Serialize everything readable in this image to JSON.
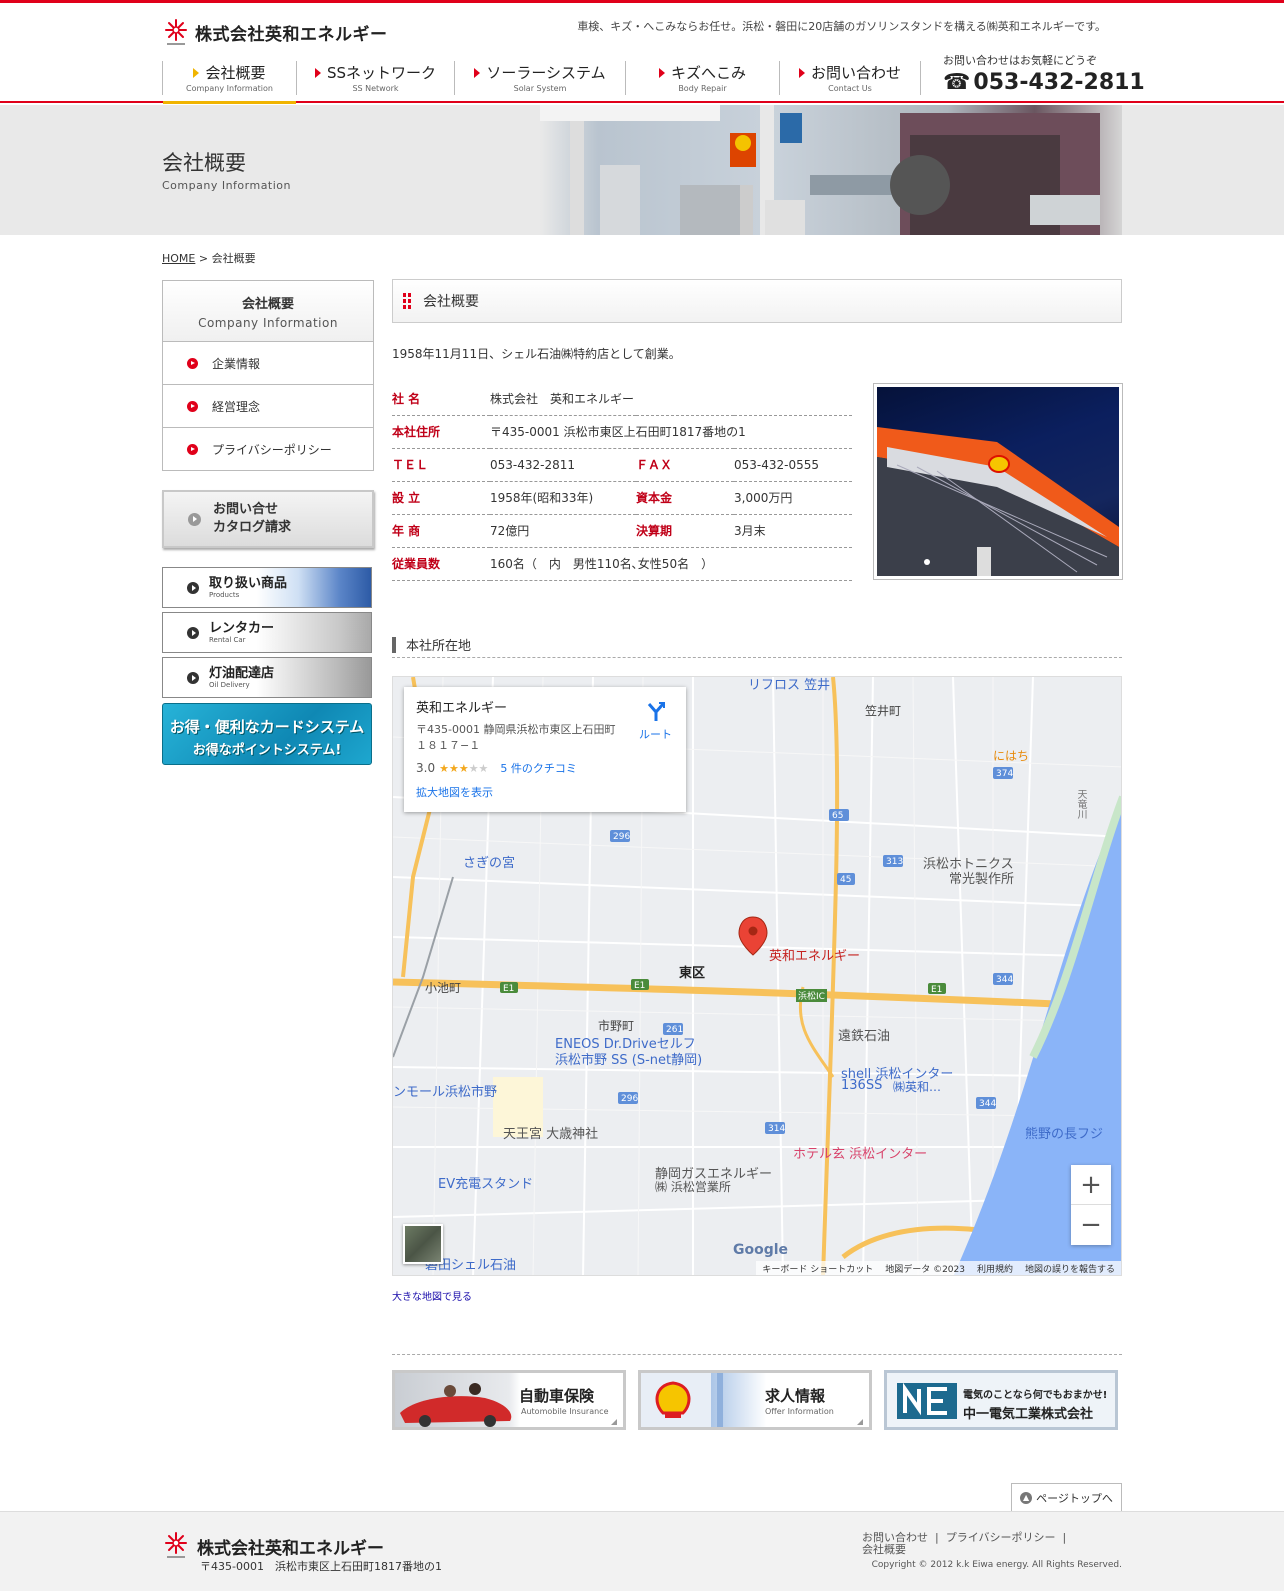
{
  "header": {
    "logo_text": "株式会社英和エネルギー",
    "tagline": "車検、キズ・へこみならお任せ。浜松・磐田に20店舗のガソリンスタンドを構える㈱英和エネルギーです。",
    "tel_note": "お問い合わせはお気軽にどうぞ",
    "tel": "053-432-2811",
    "nav": [
      {
        "jp": "会社概要",
        "en": "Company Information"
      },
      {
        "jp": "SSネットワーク",
        "en": "SS Network"
      },
      {
        "jp": "ソーラーシステム",
        "en": "Solar System"
      },
      {
        "jp": "キズへこみ",
        "en": "Body Repair"
      },
      {
        "jp": "お問い合わせ",
        "en": "Contact Us"
      }
    ]
  },
  "hero": {
    "title": "会社概要",
    "subtitle": "Company Information"
  },
  "breadcrumb": {
    "home": "HOME",
    "sep": " > ",
    "current": "会社概要"
  },
  "sidebar": {
    "head_jp": "会社概要",
    "head_en": "Company Information",
    "items": [
      "企業情報",
      "経営理念",
      "プライバシーポリシー"
    ],
    "contact_l1": "お問い合せ",
    "contact_l2": "カタログ請求",
    "banners": [
      {
        "jp": "取り扱い商品",
        "en": "Products"
      },
      {
        "jp": "レンタカー",
        "en": "Rental Car"
      },
      {
        "jp": "灯油配達店",
        "en": "Oil Delivery"
      }
    ],
    "card_l1": "お得・便利なカードシステム",
    "card_l2": "お得なポイントシステム!"
  },
  "main": {
    "section_title": "会社概要",
    "intro": "1958年11月11日、シェル石油㈱特約店として創業。",
    "info": {
      "name_k": "社 名",
      "name_v": "株式会社　英和エネルギー",
      "addr_k": "本社住所",
      "addr_v": "〒435-0001 浜松市東区上石田町1817番地の1",
      "tel_k": "ＴＥＬ",
      "tel_v": "053-432-2811",
      "fax_k": "ＦＡＸ",
      "fax_v": "053-432-0555",
      "est_k": "設 立",
      "est_v": "1958年(昭和33年)",
      "cap_k": "資本金",
      "cap_v": "3,000万円",
      "sales_k": "年 商",
      "sales_v": "72億円",
      "fy_k": "決算期",
      "fy_v": "3月末",
      "emp_k": "従業員数",
      "emp_v": "160名（　内　男性110名､女性50名　）"
    },
    "map_title": "本社所在地",
    "map": {
      "card_name": "英和エネルギー",
      "card_addr": "〒435-0001 静岡県浜松市東区上石田町１８１７−１",
      "rating": "3.0",
      "reviews": "5 件のクチコミ",
      "enlarge": "拡大地図を表示",
      "route": "ルート",
      "pin_label": "英和エネルギー",
      "labels": {
        "l1": "リフロス 笠井",
        "l2": "笠井町",
        "l3": "にはち",
        "l4": "さぎの宮",
        "l5": "浜松ホトニクス",
        "l6": "常光製作所",
        "l7": "東区",
        "l8": "小池町",
        "l9": "浜松IC",
        "l10": "市野町",
        "l11": "遠鉄石油",
        "l12": "ENEOS Dr.Driveセルフ",
        "l13": "浜松市野 SS (S-net静岡)",
        "l14": "shell 浜松インター",
        "l15": "136SS",
        "l16": "㈱英和…",
        "l17": "ンモール浜松市野",
        "l18": "天王宮 大歳神社",
        "l19": "ホテル玄 浜松インター",
        "l20": "熊野の長フジ",
        "l21": "EV充電スタンド",
        "l22": "静岡ガスエネルギー",
        "l23": "㈱ 浜松営業所",
        "l24": "磐田シェル石油",
        "l25": "天竜川"
      },
      "footer": [
        "キーボード ショートカット",
        "地図データ ©2023",
        "利用規約",
        "地図の誤りを報告する"
      ],
      "google": "Google"
    },
    "big_map_link": "大きな地図で見る",
    "bottom_banners": [
      {
        "jp": "自動車保険",
        "en": "Automobile Insurance"
      },
      {
        "jp": "求人情報",
        "en": "Offer Information"
      },
      {
        "jp": "電気のことなら何でもおまかせ!",
        "en": "中一電気工業株式会社"
      }
    ]
  },
  "pagetop": "ページトップへ",
  "footer": {
    "name": "株式会社英和エネルギー",
    "addr": "〒435-0001　浜松市東区上石田町1817番地の1",
    "links": [
      "お問い合わせ",
      "プライバシーポリシー",
      "会社概要"
    ],
    "copyright": "Copyright © 2012 k.k Eiwa energy. All Rights Reserved."
  },
  "colors": {
    "accent": "#e0001a",
    "nav_active": "#f0b400",
    "label_red": "#c00018"
  }
}
